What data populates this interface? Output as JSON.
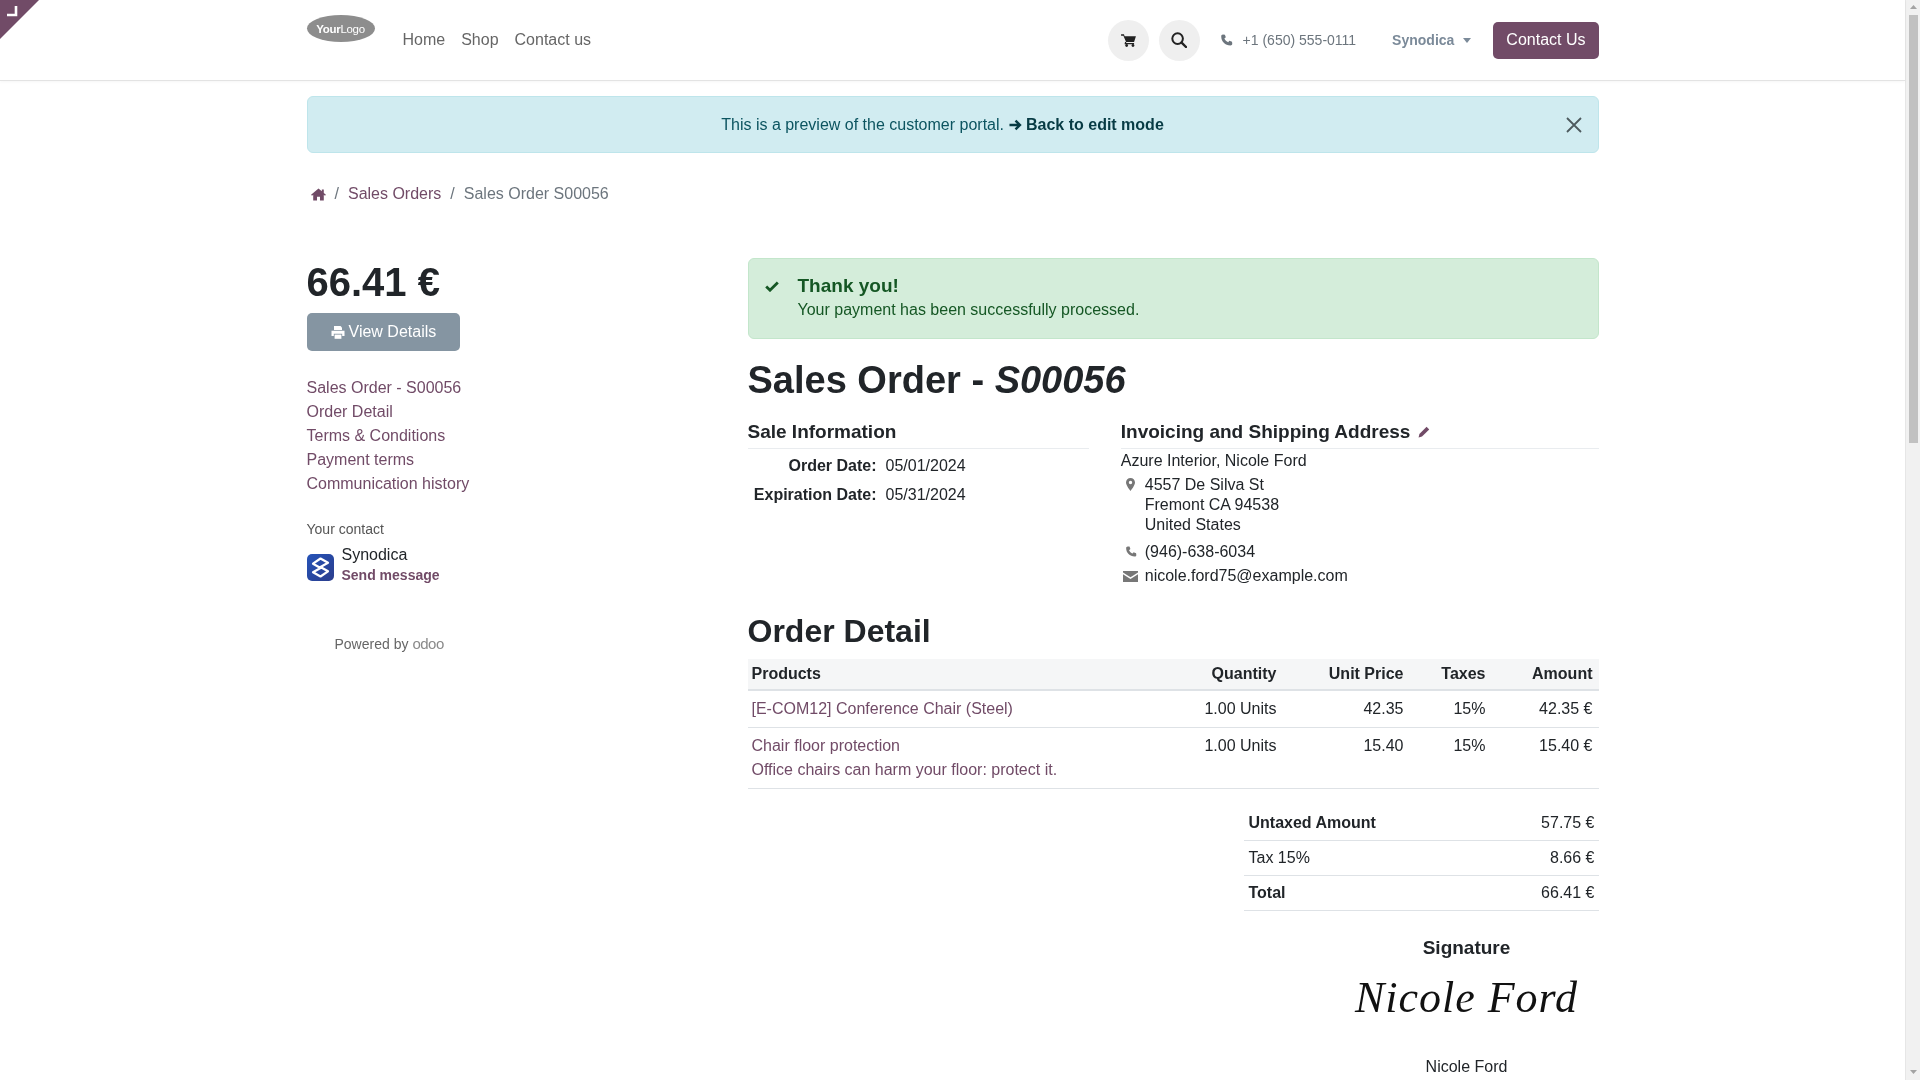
{
  "header": {
    "logo": "**Your**Logo",
    "nav": [
      "Home",
      "Shop",
      "Contact us"
    ],
    "phone": "+1 (650) 555-0111",
    "company_menu": "Synodica",
    "cta": "Contact Us"
  },
  "preview_banner": {
    "text": "This is a preview of the customer portal.",
    "link": "Back to edit mode"
  },
  "breadcrumb": [
    {
      "kind": "home"
    },
    {
      "kind": "separator",
      "text": "/"
    },
    {
      "kind": "link",
      "text": "Sales Orders"
    },
    {
      "kind": "separator",
      "text": "/"
    },
    {
      "kind": "current",
      "text": "Sales Order S00056"
    }
  ],
  "sidebar": {
    "total": "66.41 €",
    "view_button": "View Details",
    "links": [
      "Sales Order - S00056",
      "Order Detail",
      "Terms & Conditions",
      "Payment terms",
      "Communication history"
    ],
    "contact_heading": "Your contact",
    "contact": {
      "name": "Synodica",
      "action": "Send message"
    },
    "powered_by": "Powered by",
    "brand": "odoo"
  },
  "payment_alert": {
    "title": "Thank you!",
    "message": "Your payment has been successfully processed."
  },
  "order": {
    "title": "Sales Order - *S00056*",
    "sale_information": {
      "heading": "Sale Information",
      "fields": [
        {
          "label": "Order Date:",
          "value": "05/01/2024"
        },
        {
          "label": "Expiration Date:",
          "value": "05/31/2024"
        }
      ]
    },
    "address": {
      "heading": "Invoicing and Shipping Address",
      "name": "Azure Interior, Nicole Ford",
      "street_lines": [
        "4557 De Silva St",
        "Fremont CA 94538",
        "United States"
      ],
      "phone": "(946)-638-6034",
      "email": "nicole.ford75@example.com"
    },
    "detail": {
      "heading": "Order Detail",
      "columns": [
        "Products",
        "Quantity",
        "Unit Price",
        "Taxes",
        "Amount"
      ],
      "rows": [
        {
          "product": "[E-COM12] Conference Chair (Steel)",
          "quantity": "1.00 Units",
          "unit_price": "42.35",
          "taxes": "15%",
          "amount": "42.35 €"
        },
        {
          "product": "Chair floor protection",
          "description": "Office chairs can harm your floor: protect it.",
          "quantity": "1.00 Units",
          "unit_price": "15.40",
          "taxes": "15%",
          "amount": "15.40 €"
        }
      ],
      "totals": [
        {
          "kind": "subtotal",
          "label": "Untaxed Amount",
          "value": "57.75 €"
        },
        {
          "kind": "tax",
          "label": "Tax 15%",
          "value": "8.66 €"
        },
        {
          "kind": "total",
          "label": "Total",
          "value": "66.41 €"
        }
      ]
    },
    "signature": {
      "heading": "Signature",
      "handwriting": "Nicole Ford",
      "name": "Nicole Ford"
    }
  }
}
